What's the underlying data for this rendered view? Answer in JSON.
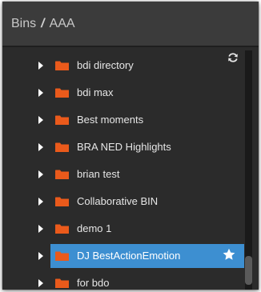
{
  "header": {
    "root": "Bins",
    "separator": "/",
    "current": "AAA"
  },
  "tree": {
    "items": [
      {
        "label": "bdi directory",
        "selected": false
      },
      {
        "label": "bdi max",
        "selected": false
      },
      {
        "label": "Best moments",
        "selected": false
      },
      {
        "label": "BRA NED Highlights",
        "selected": false
      },
      {
        "label": "brian test",
        "selected": false
      },
      {
        "label": "Collaborative BIN",
        "selected": false
      },
      {
        "label": "demo 1",
        "selected": false
      },
      {
        "label": "DJ BestActionEmotion",
        "selected": true
      },
      {
        "label": "for bdo",
        "selected": false
      }
    ]
  },
  "icons": {
    "refresh": "refresh-icon",
    "folder": "folder-icon",
    "expand": "chevron-right-icon",
    "favorite": "star-icon"
  },
  "colors": {
    "panel_bg": "#2b2b2b",
    "header_bg": "#3b3b3b",
    "folder": "#ea5a1b",
    "selection": "#3d8fd1",
    "text": "#e6e6e6"
  }
}
